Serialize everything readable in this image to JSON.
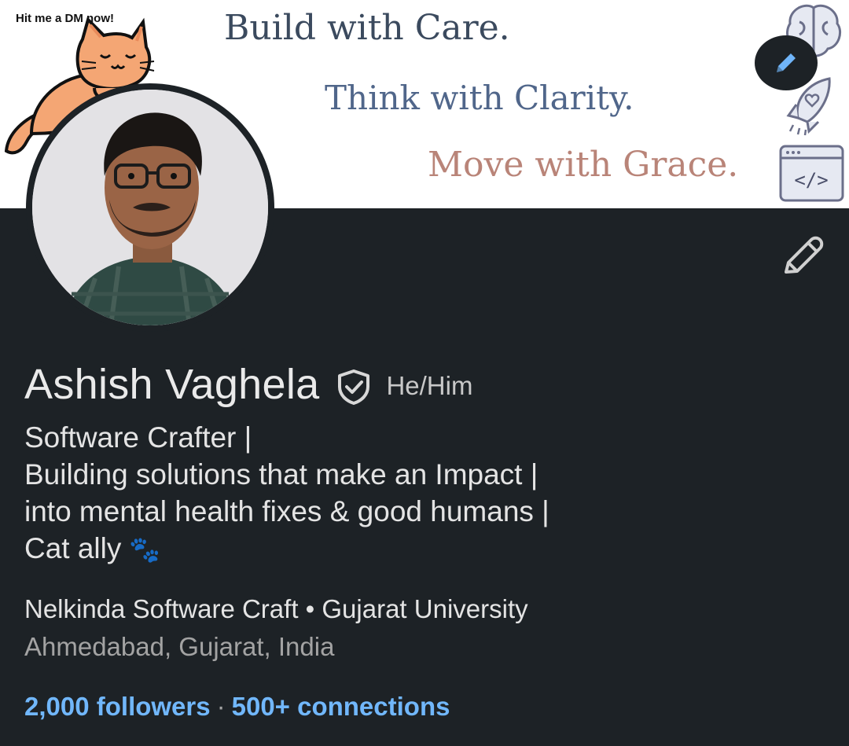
{
  "banner": {
    "dm_text": "Hit me a DM now!",
    "line1": "Build with Care.",
    "line2": "Think with Clarity.",
    "line3": "Move with Grace."
  },
  "profile": {
    "name": "Ashish Vaghela",
    "pronouns": "He/Him",
    "headline": [
      "Software Crafter |",
      "Building solutions that make an Impact |",
      "into mental health fixes & good humans |",
      "Cat ally"
    ],
    "headline_emoji": "🐾",
    "company": "Nelkinda Software Craft",
    "separator": " • ",
    "education": "Gujarat University",
    "location": "Ahmedabad, Gujarat, India",
    "followers": "2,000 followers",
    "stats_separator": "·",
    "connections": "500+ connections"
  },
  "icons": {
    "banner_edit": "pencil-icon",
    "profile_edit": "pencil-icon",
    "verified": "verified-shield-icon"
  },
  "colors": {
    "background": "#1d2226",
    "link": "#71b7fb",
    "accent": "#70b5f9"
  }
}
